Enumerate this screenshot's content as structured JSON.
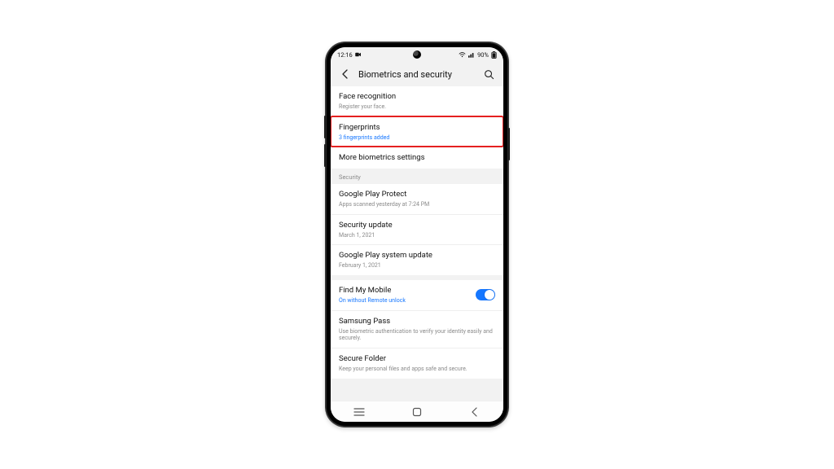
{
  "statusbar": {
    "time": "12:16",
    "battery_text": "90%"
  },
  "header": {
    "title": "Biometrics and security"
  },
  "groups": [
    {
      "rows": [
        {
          "label": "Face recognition",
          "sub": "Register your face."
        },
        {
          "label": "Fingerprints",
          "sub": "3 fingerprints added",
          "sub_link": true,
          "highlight": true
        },
        {
          "label": "More biometrics settings"
        }
      ]
    },
    {
      "section": "Security",
      "rows": [
        {
          "label": "Google Play Protect",
          "sub": "Apps scanned yesterday at 7:24 PM"
        },
        {
          "label": "Security update",
          "sub": "March 1, 2021"
        },
        {
          "label": "Google Play system update",
          "sub": "February 1, 2021"
        }
      ]
    },
    {
      "rows": [
        {
          "label": "Find My Mobile",
          "sub": "On without Remote unlock",
          "sub_link": true,
          "toggle": true
        },
        {
          "label": "Samsung Pass",
          "sub": "Use biometric authentication to verify your identity easily and securely."
        },
        {
          "label": "Secure Folder",
          "sub": "Keep your personal files and apps safe and secure."
        }
      ]
    }
  ]
}
